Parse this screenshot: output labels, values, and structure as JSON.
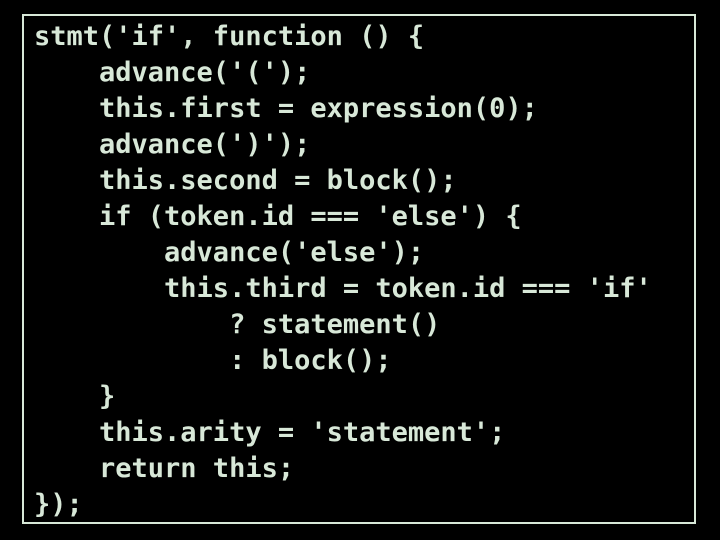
{
  "code": {
    "lines": [
      "stmt('if', function () {",
      "    advance('(');",
      "    this.first = expression(0);",
      "    advance(')');",
      "    this.second = block();",
      "    if (token.id === 'else') {",
      "        advance('else');",
      "        this.third = token.id === 'if'",
      "            ? statement()",
      "            : block();",
      "    }",
      "    this.arity = 'statement';",
      "    return this;",
      "});"
    ]
  }
}
